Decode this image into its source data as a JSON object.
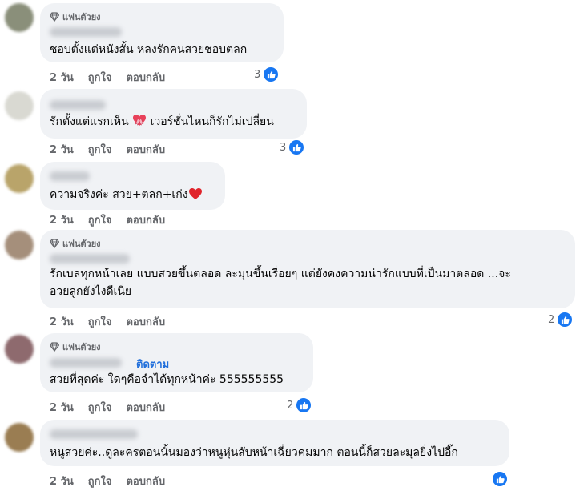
{
  "actions": {
    "time": "2 วัน",
    "like": "ถูกใจ",
    "reply": "ตอบกลับ"
  },
  "badge_label": "แฟนตัวยง",
  "follow_label": "ติดตาม",
  "comments": [
    {
      "badge": true,
      "text": "ชอบตั้งแต่หนังสั้น หลงรักคนสวยชอบตลก",
      "like_count": "3"
    },
    {
      "badge": false,
      "text_before": "รักตั้งแต่แรกเห็น",
      "text_after": "เวอร์ชั่นไหนก็รักไม่เปลี่ยน",
      "emoji": "heart-ribbon-icon",
      "like_count": "3"
    },
    {
      "badge": false,
      "text": "ความจริงค่ะ สวย+ตลก+เก่ง",
      "emoji": "red-heart-icon",
      "like_count": ""
    },
    {
      "badge": true,
      "text_line1": "รักเบลทุกหน้าเลย แบบสวยขึ้นตลอด ละมุนขึ้นเรื่อยๆ แต่ยังคงความน่ารักแบบที่เป็นมาตลอด ...จะ",
      "text_line2": "อวยลูกยังไงดีเนี่ย",
      "like_count": "2"
    },
    {
      "badge": true,
      "follow": true,
      "text": "สวยที่สุดค่ะ ใดๆคือจำได้ทุกหน้าค่ะ 555555555",
      "like_count": "2"
    },
    {
      "badge": false,
      "text": "หนูสวยค่ะ..ดูละครตอนนั้นมองว่าหนูหุ่นสับหน้าเฉี่ยวคมมาก ตอนนี้ก็สวยละมุลยิ่งไปอี๊ก",
      "like_count": ""
    }
  ],
  "colors": {
    "bubble": "#f0f2f5",
    "like_blue": "#1877f2",
    "meta_gray": "#65676b",
    "follow_blue": "#216fdb"
  }
}
